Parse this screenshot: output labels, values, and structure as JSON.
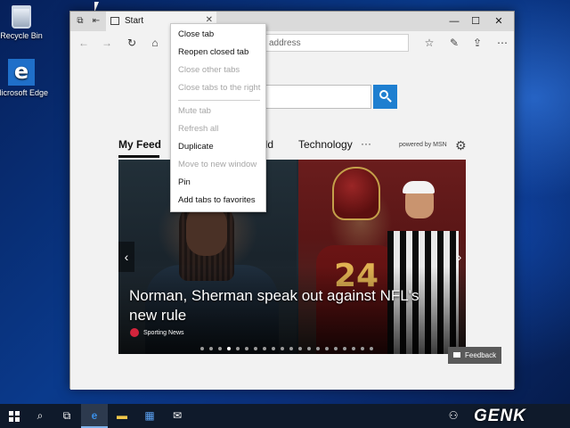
{
  "desktop": {
    "icons": [
      {
        "label": "Recycle Bin",
        "icon": "recycle-bin-icon"
      },
      {
        "label": "Microsoft Edge",
        "icon": "edge-icon"
      }
    ]
  },
  "browser": {
    "tab_title": "Start",
    "address_placeholder": "address",
    "feed": {
      "tabs": [
        "My Feed",
        "orld",
        "Technology"
      ],
      "more": "···",
      "powered_by": "powered by MSN"
    },
    "hero": {
      "headline": "Norman, Sherman speak out against NFL's new rule",
      "source": "Sporting News",
      "slide_count": 20,
      "active_slide": 3
    },
    "feedback_label": "Feedback"
  },
  "context_menu": {
    "items": [
      {
        "label": "Close tab",
        "enabled": true
      },
      {
        "label": "Reopen closed tab",
        "enabled": true
      },
      {
        "label": "Close other tabs",
        "enabled": false
      },
      {
        "label": "Close tabs to the right",
        "enabled": false
      },
      {
        "label": "Mute tab",
        "enabled": false
      },
      {
        "label": "Refresh all",
        "enabled": false
      },
      {
        "label": "Duplicate",
        "enabled": true
      },
      {
        "label": "Move to new window",
        "enabled": false
      },
      {
        "label": "Pin",
        "enabled": true
      },
      {
        "label": "Add tabs to favorites",
        "enabled": true
      }
    ]
  },
  "taskbar": {
    "watermark": "GENK"
  },
  "colors": {
    "accent": "#1e7fd0",
    "taskbar": "#0f1a2b",
    "feedback_bg": "#5a5a5a",
    "source_badge": "#d2243c"
  }
}
